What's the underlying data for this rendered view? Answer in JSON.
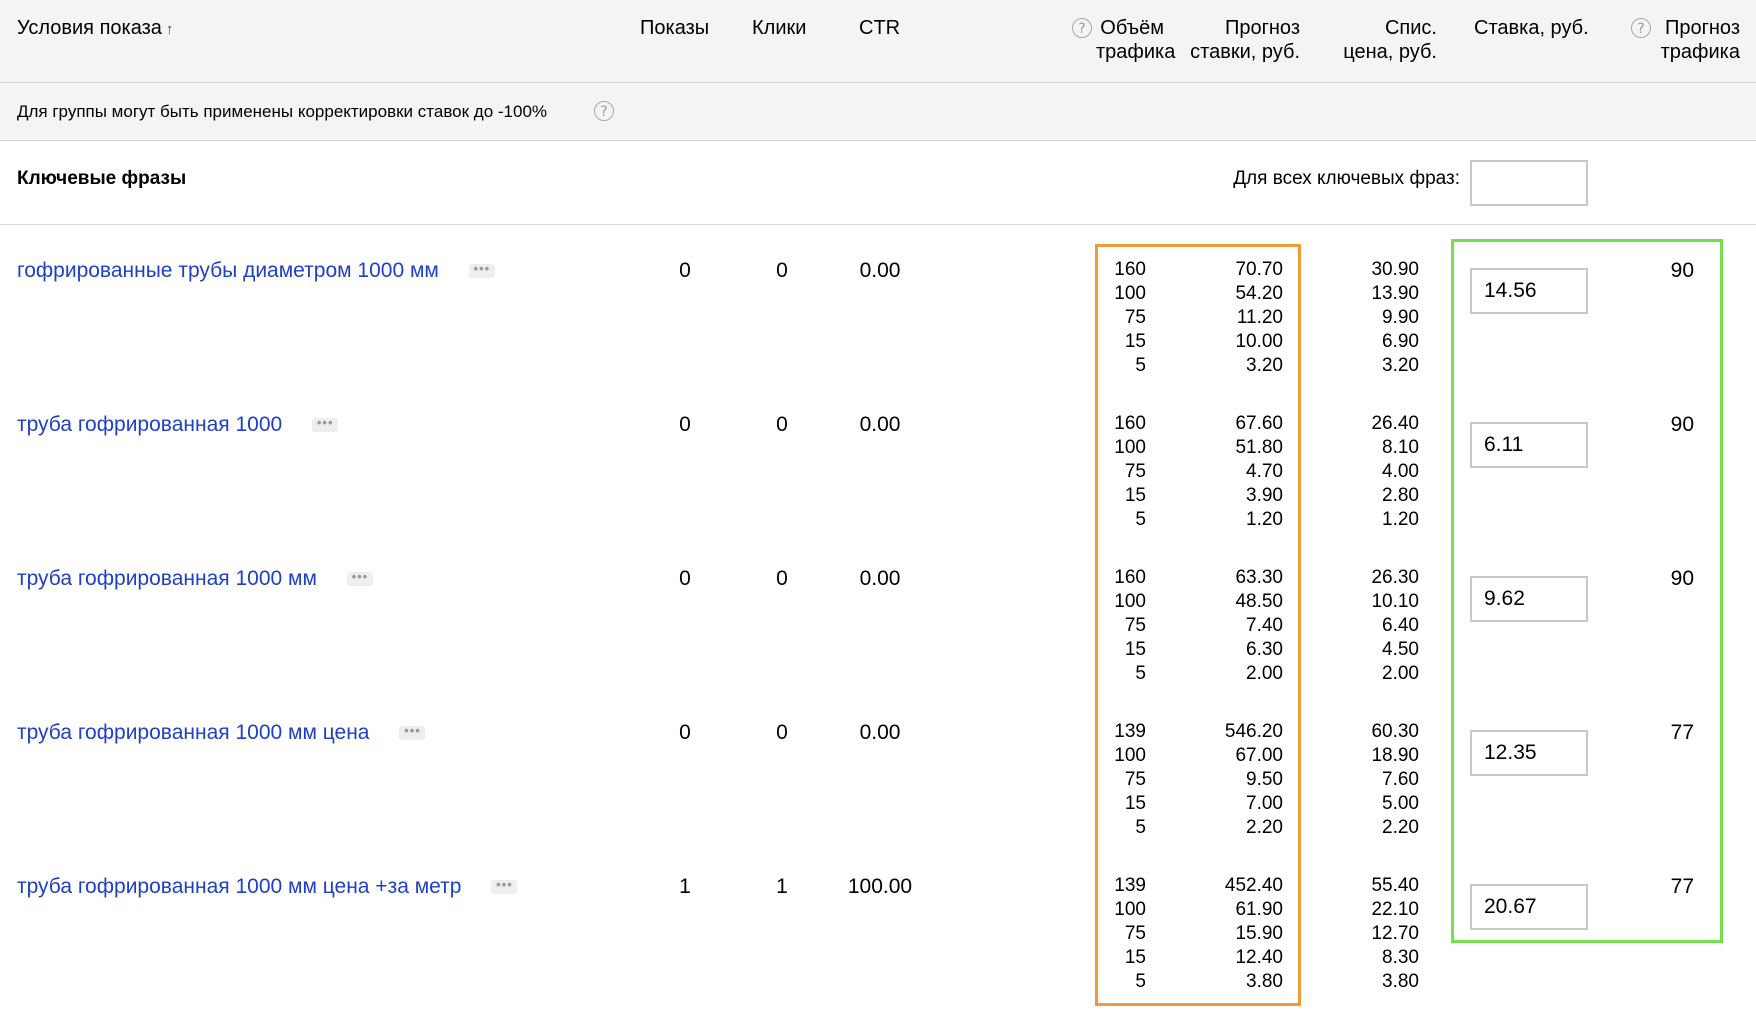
{
  "header": {
    "conditions": "Условия показа",
    "sort_arrow": "↑",
    "shows": "Показы",
    "clicks": "Клики",
    "ctr": "CTR",
    "traffic_volume_1": "Объём",
    "traffic_volume_2": "трафика",
    "bid_forecast_1": "Прогноз",
    "bid_forecast_2": "ставки, руб.",
    "charged_price_1": "Спис.",
    "charged_price_2": "цена, руб.",
    "bid": "Ставка, руб.",
    "traffic_forecast_1": "Прогноз",
    "traffic_forecast_2": "трафика",
    "help_glyph": "?"
  },
  "notice": {
    "text": "Для группы могут быть применены корректировки ставок до -100%"
  },
  "keywords": {
    "title": "Ключевые фразы",
    "all_label": "Для всех ключевых фраз:",
    "all_value": ""
  },
  "more_glyph": "•••",
  "rows": [
    {
      "phrase": "гофрированные трубы диаметром 1000 мм",
      "shows": "0",
      "clicks": "0",
      "ctr": "0.00",
      "volume": [
        "160",
        "100",
        "75",
        "15",
        "5"
      ],
      "bid_forecast": [
        "70.70",
        "54.20",
        "11.20",
        "10.00",
        "3.20"
      ],
      "charged": [
        "30.90",
        "13.90",
        "9.90",
        "6.90",
        "3.20"
      ],
      "bid": "14.56",
      "traffic_forecast": "90"
    },
    {
      "phrase": "труба гофрированная 1000",
      "shows": "0",
      "clicks": "0",
      "ctr": "0.00",
      "volume": [
        "160",
        "100",
        "75",
        "15",
        "5"
      ],
      "bid_forecast": [
        "67.60",
        "51.80",
        "4.70",
        "3.90",
        "1.20"
      ],
      "charged": [
        "26.40",
        "8.10",
        "4.00",
        "2.80",
        "1.20"
      ],
      "bid": "6.11",
      "traffic_forecast": "90"
    },
    {
      "phrase": "труба гофрированная 1000 мм",
      "shows": "0",
      "clicks": "0",
      "ctr": "0.00",
      "volume": [
        "160",
        "100",
        "75",
        "15",
        "5"
      ],
      "bid_forecast": [
        "63.30",
        "48.50",
        "7.40",
        "6.30",
        "2.00"
      ],
      "charged": [
        "26.30",
        "10.10",
        "6.40",
        "4.50",
        "2.00"
      ],
      "bid": "9.62",
      "traffic_forecast": "90"
    },
    {
      "phrase": "труба гофрированная 1000 мм цена",
      "shows": "0",
      "clicks": "0",
      "ctr": "0.00",
      "volume": [
        "139",
        "100",
        "75",
        "15",
        "5"
      ],
      "bid_forecast": [
        "546.20",
        "67.00",
        "9.50",
        "7.00",
        "2.20"
      ],
      "charged": [
        "60.30",
        "18.90",
        "7.60",
        "5.00",
        "2.20"
      ],
      "bid": "12.35",
      "traffic_forecast": "77"
    },
    {
      "phrase": "труба гофрированная 1000 мм цена +за метр",
      "shows": "1",
      "clicks": "1",
      "ctr": "100.00",
      "volume": [
        "139",
        "100",
        "75",
        "15",
        "5"
      ],
      "bid_forecast": [
        "452.40",
        "61.90",
        "15.90",
        "12.40",
        "3.80"
      ],
      "charged": [
        "55.40",
        "22.10",
        "12.70",
        "8.30",
        "3.80"
      ],
      "bid": "20.67",
      "traffic_forecast": "77"
    }
  ],
  "highlight_colors": {
    "forecast_box": "#f29a38",
    "bid_box": "#74e04c",
    "link": "#1f3fc8"
  }
}
